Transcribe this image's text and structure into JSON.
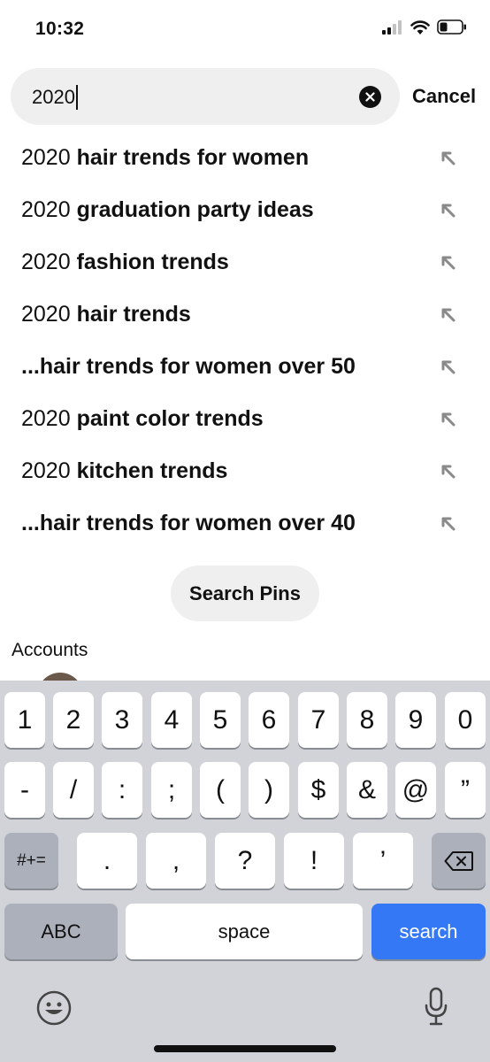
{
  "status_bar": {
    "time": "10:32"
  },
  "search": {
    "query": "2020",
    "cancel_label": "Cancel"
  },
  "suggestions": [
    {
      "typed": "2020",
      "rest": " hair trends for women"
    },
    {
      "typed": "2020",
      "rest": " graduation party ideas"
    },
    {
      "typed": "2020",
      "rest": " fashion trends"
    },
    {
      "typed": "2020",
      "rest": " hair trends"
    },
    {
      "typed": "",
      "rest": "...hair trends for women over 50"
    },
    {
      "typed": "2020",
      "rest": " paint color trends"
    },
    {
      "typed": "2020",
      "rest": " kitchen trends"
    },
    {
      "typed": "",
      "rest": "...hair trends for women over 40"
    }
  ],
  "search_pins_label": "Search Pins",
  "accounts_label": "Accounts",
  "keyboard": {
    "row1": [
      "1",
      "2",
      "3",
      "4",
      "5",
      "6",
      "7",
      "8",
      "9",
      "0"
    ],
    "row2": [
      "-",
      "/",
      ":",
      ";",
      "(",
      ")",
      "$",
      "&",
      "@",
      "”"
    ],
    "symbols_label": "#+=",
    "row3": [
      ".",
      ",",
      "?",
      "!",
      "’"
    ],
    "abc_label": "ABC",
    "space_label": "space",
    "search_label": "search"
  },
  "colors": {
    "search_key": "#3478f6",
    "keyboard_bg": "#d1d3d9",
    "search_field_bg": "#efefef"
  }
}
